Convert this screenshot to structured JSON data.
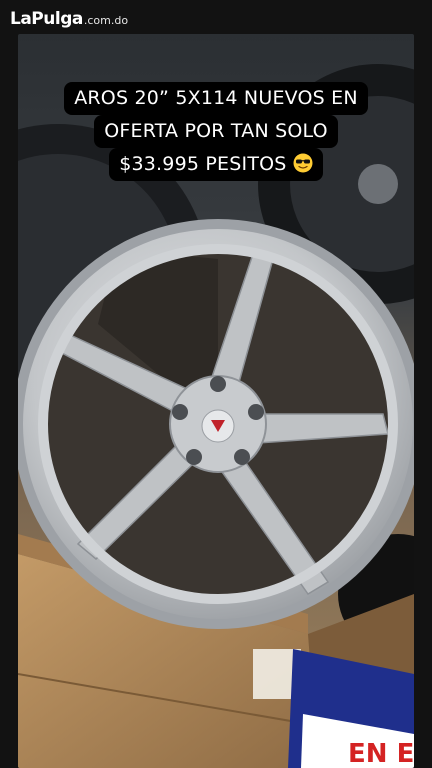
{
  "watermark": {
    "brand": "LaPulga",
    "domain": ".com.do"
  },
  "caption": {
    "lines": [
      "AROS 20” 5X114 NUEVOS EN",
      "OFERTA POR TAN SOLO",
      "$33.995 PESITOS"
    ],
    "emoji": "sunglasses-face-icon"
  },
  "box_print": {
    "sign_text": "EN E"
  },
  "colors": {
    "rim_silver": "#c9cccf",
    "box_cardboard": "#b18a5c",
    "sign_blue": "#1f2f8c",
    "sign_red": "#d42323"
  }
}
